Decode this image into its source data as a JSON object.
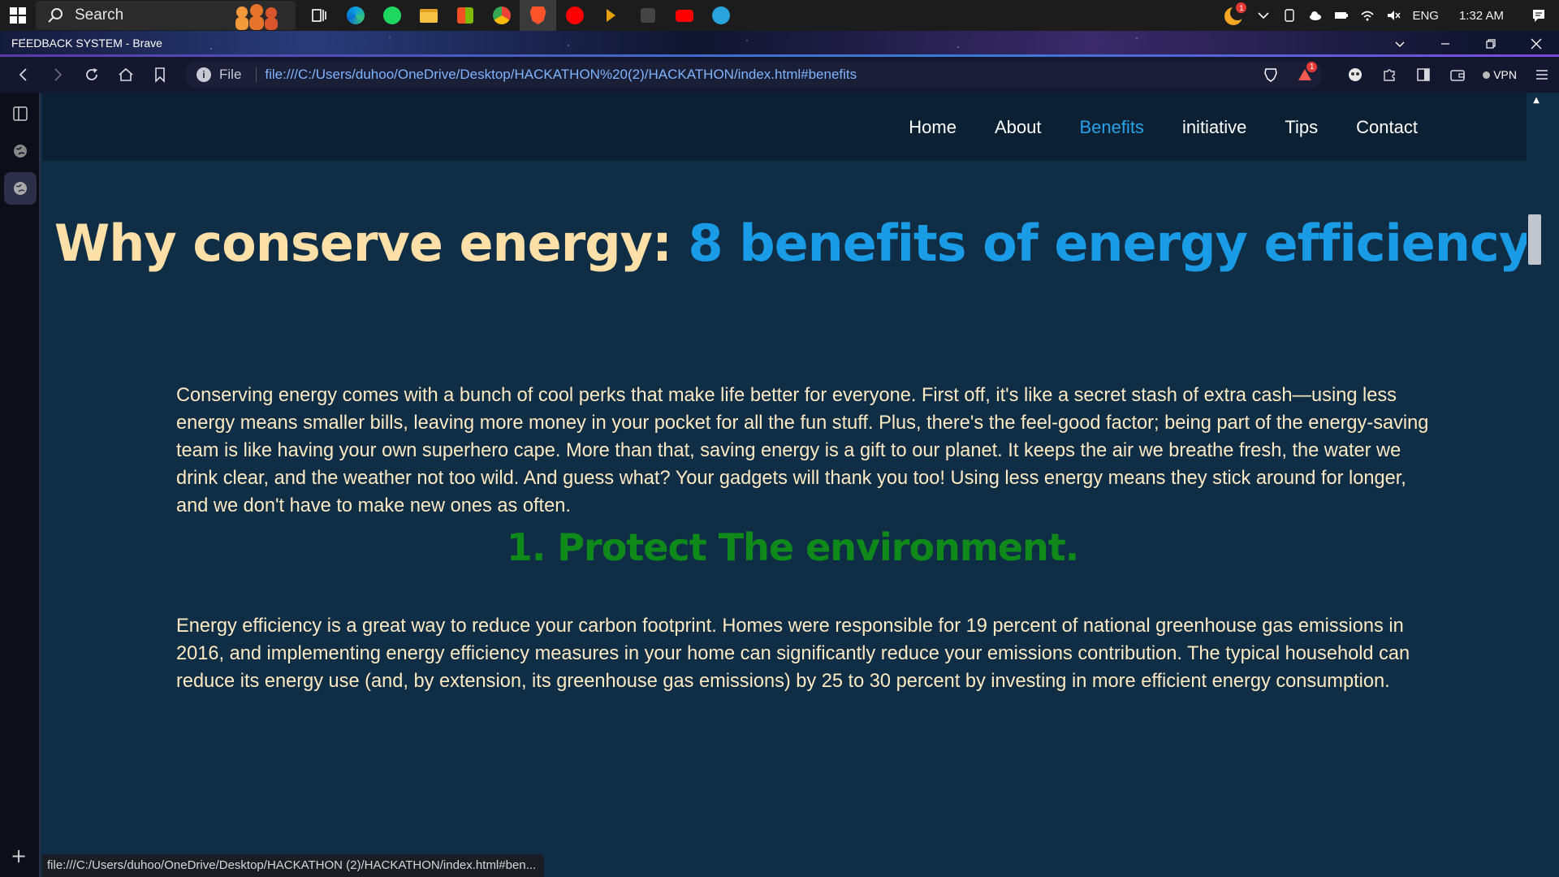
{
  "taskbar": {
    "search_placeholder": "Search",
    "apps": [
      "task-view",
      "edge",
      "spotify",
      "file-explorer",
      "microsoft-store",
      "chrome",
      "brave",
      "youtube-music",
      "plex",
      "lively",
      "youtube",
      "telegram"
    ],
    "tray": {
      "notification_badge": "1",
      "language": "ENG",
      "time": "1:32 AM"
    }
  },
  "browser": {
    "window_title": "FEEDBACK SYSTEM - Brave",
    "scheme_label": "File",
    "url": "file:///C:/Users/duhoo/OneDrive/Desktop/HACKATHON%20(2)/HACKATHON/index.html#benefits",
    "rewards_badge": "1",
    "vpn_label": "VPN",
    "status_url": "file:///C:/Users/duhoo/OneDrive/Desktop/HACKATHON (2)/HACKATHON/index.html#ben..."
  },
  "site": {
    "nav": [
      {
        "label": "Home"
      },
      {
        "label": "About"
      },
      {
        "label": "Benefits"
      },
      {
        "label": "initiative"
      },
      {
        "label": "Tips"
      },
      {
        "label": "Contact"
      }
    ],
    "active_nav": "Benefits",
    "heading_part1": "Why conserve energy: ",
    "heading_part2": "8 benefits of energy efficiency",
    "intro": "Conserving energy comes with a bunch of cool perks that make life better for everyone. First off, it's like a secret stash of extra cash—using less energy means smaller bills, leaving more money in your pocket for all the fun stuff. Plus, there's the feel-good factor; being part of the energy-saving team is like having your own superhero cape. More than that, saving energy is a gift to our planet. It keeps the air we breathe fresh, the water we drink clear, and the weather not too wild. And guess what? Your gadgets will thank you too! Using less energy means they stick around for longer, and we don't have to make new ones as often.",
    "section1_title": "1. Protect The environment.",
    "section1_text": "Energy efficiency is a great way to reduce your carbon footprint. Homes were responsible for 19 percent of national greenhouse gas emissions in 2016, and implementing energy efficiency measures in your home can significantly reduce your emissions contribution. The typical household can reduce its energy use (and, by extension, its greenhouse gas emissions) by 25 to 30 percent by investing in more efficient energy consumption."
  },
  "colors": {
    "page_bg": "#0f2d45",
    "header_bg": "#0b2133",
    "accent_blue": "#1a9be6",
    "heading_cream": "#fde0a8",
    "section_green": "#0f8a1a",
    "text_cream": "#fde9c2"
  }
}
